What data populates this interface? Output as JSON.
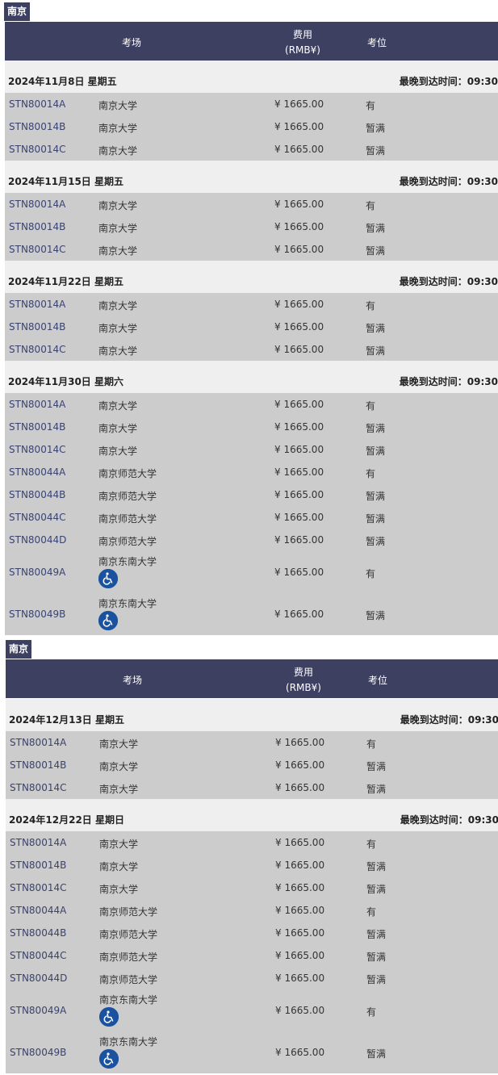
{
  "blocks": [
    {
      "city": "南京",
      "header": {
        "venue": "考场",
        "fee_line1": "费用",
        "fee_line2": "(RMB¥)",
        "seats": "考位"
      },
      "dates": [
        {
          "date": "2024年11月8日 星期五",
          "latest": "最晚到达时间：09:30",
          "rows": [
            {
              "code": "STN80014A",
              "venue": "南京大学",
              "fee": "¥ 1665.00",
              "seat": "有"
            },
            {
              "code": "STN80014B",
              "venue": "南京大学",
              "fee": "¥ 1665.00",
              "seat": "暂满"
            },
            {
              "code": "STN80014C",
              "venue": "南京大学",
              "fee": "¥ 1665.00",
              "seat": "暂满"
            }
          ]
        },
        {
          "date": "2024年11月15日 星期五",
          "latest": "最晚到达时间：09:30",
          "rows": [
            {
              "code": "STN80014A",
              "venue": "南京大学",
              "fee": "¥ 1665.00",
              "seat": "有"
            },
            {
              "code": "STN80014B",
              "venue": "南京大学",
              "fee": "¥ 1665.00",
              "seat": "暂满"
            },
            {
              "code": "STN80014C",
              "venue": "南京大学",
              "fee": "¥ 1665.00",
              "seat": "暂满"
            }
          ]
        },
        {
          "date": "2024年11月22日 星期五",
          "latest": "最晚到达时间：09:30",
          "rows": [
            {
              "code": "STN80014A",
              "venue": "南京大学",
              "fee": "¥ 1665.00",
              "seat": "有"
            },
            {
              "code": "STN80014B",
              "venue": "南京大学",
              "fee": "¥ 1665.00",
              "seat": "暂满"
            },
            {
              "code": "STN80014C",
              "venue": "南京大学",
              "fee": "¥ 1665.00",
              "seat": "暂满"
            }
          ]
        },
        {
          "date": "2024年11月30日 星期六",
          "latest": "最晚到达时间：09:30",
          "rows": [
            {
              "code": "STN80014A",
              "venue": "南京大学",
              "fee": "¥ 1665.00",
              "seat": "有"
            },
            {
              "code": "STN80014B",
              "venue": "南京大学",
              "fee": "¥ 1665.00",
              "seat": "暂满"
            },
            {
              "code": "STN80014C",
              "venue": "南京大学",
              "fee": "¥ 1665.00",
              "seat": "暂满"
            },
            {
              "code": "STN80044A",
              "venue": "南京师范大学",
              "fee": "¥ 1665.00",
              "seat": "有"
            },
            {
              "code": "STN80044B",
              "venue": "南京师范大学",
              "fee": "¥ 1665.00",
              "seat": "暂满"
            },
            {
              "code": "STN80044C",
              "venue": "南京师范大学",
              "fee": "¥ 1665.00",
              "seat": "暂满"
            },
            {
              "code": "STN80044D",
              "venue": "南京师范大学",
              "fee": "¥ 1665.00",
              "seat": "暂满"
            },
            {
              "code": "STN80049A",
              "venue": "南京东南大学",
              "fee": "¥ 1665.00",
              "seat": "有",
              "accessible": true
            },
            {
              "code": "STN80049B",
              "venue": "南京东南大学",
              "fee": "¥ 1665.00",
              "seat": "暂满",
              "accessible": true
            }
          ]
        }
      ]
    },
    {
      "city": "南京",
      "header": {
        "venue": "考场",
        "fee_line1": "费用",
        "fee_line2": "(RMB¥)",
        "seats": "考位"
      },
      "dates": [
        {
          "date": "2024年12月13日 星期五",
          "latest": "最晚到达时间：09:30",
          "rows": [
            {
              "code": "STN80014A",
              "venue": "南京大学",
              "fee": "¥ 1665.00",
              "seat": "有"
            },
            {
              "code": "STN80014B",
              "venue": "南京大学",
              "fee": "¥ 1665.00",
              "seat": "暂满"
            },
            {
              "code": "STN80014C",
              "venue": "南京大学",
              "fee": "¥ 1665.00",
              "seat": "暂满"
            }
          ]
        },
        {
          "date": "2024年12月22日 星期日",
          "latest": "最晚到达时间：09:30",
          "rows": [
            {
              "code": "STN80014A",
              "venue": "南京大学",
              "fee": "¥ 1665.00",
              "seat": "有"
            },
            {
              "code": "STN80014B",
              "venue": "南京大学",
              "fee": "¥ 1665.00",
              "seat": "暂满"
            },
            {
              "code": "STN80014C",
              "venue": "南京大学",
              "fee": "¥ 1665.00",
              "seat": "暂满"
            },
            {
              "code": "STN80044A",
              "venue": "南京师范大学",
              "fee": "¥ 1665.00",
              "seat": "有"
            },
            {
              "code": "STN80044B",
              "venue": "南京师范大学",
              "fee": "¥ 1665.00",
              "seat": "暂满"
            },
            {
              "code": "STN80044C",
              "venue": "南京师范大学",
              "fee": "¥ 1665.00",
              "seat": "暂满"
            },
            {
              "code": "STN80044D",
              "venue": "南京师范大学",
              "fee": "¥ 1665.00",
              "seat": "暂满"
            },
            {
              "code": "STN80049A",
              "venue": "南京东南大学",
              "fee": "¥ 1665.00",
              "seat": "有",
              "accessible": true
            },
            {
              "code": "STN80049B",
              "venue": "南京东南大学",
              "fee": "¥ 1665.00",
              "seat": "暂满",
              "accessible": true
            }
          ]
        }
      ]
    }
  ]
}
